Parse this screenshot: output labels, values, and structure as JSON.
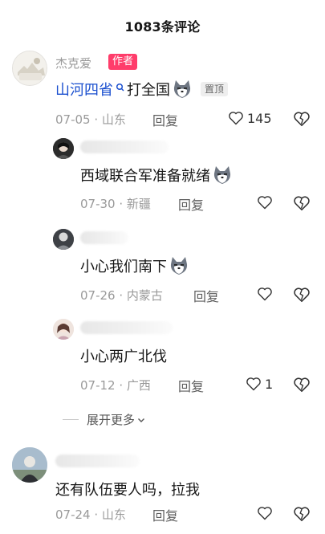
{
  "header": {
    "title": "1083条评论"
  },
  "comments": [
    {
      "user": "杰克爱",
      "badge": "作者",
      "text_link": "山河四省",
      "text_rest": "打全国",
      "pinned": "置顶",
      "date": "07-05",
      "location": "山东",
      "reply": "回复",
      "likes": "145"
    }
  ],
  "replies": [
    {
      "text": "西域联合军准备就绪",
      "date": "07-30",
      "location": "新疆",
      "reply": "回复",
      "likes": ""
    },
    {
      "text": "小心我们南下",
      "date": "07-26",
      "location": "内蒙古",
      "reply": "回复",
      "likes": ""
    },
    {
      "text": "小心两广北伐",
      "date": "07-12",
      "location": "广西",
      "reply": "回复",
      "likes": "1"
    }
  ],
  "expand": {
    "label": "展开更多"
  },
  "last_comment": {
    "text": "还有队伍要人吗，拉我",
    "date": "07-24",
    "location": "山东",
    "reply": "回复",
    "likes": ""
  },
  "colors": {
    "author_badge": "#ff3d6b",
    "link": "#1a4fcf",
    "meta": "#9a9a9a"
  },
  "icons": [
    "heart-icon",
    "broken-heart-icon",
    "search-icon",
    "wolf-emoji-icon",
    "chevron-down-icon"
  ]
}
